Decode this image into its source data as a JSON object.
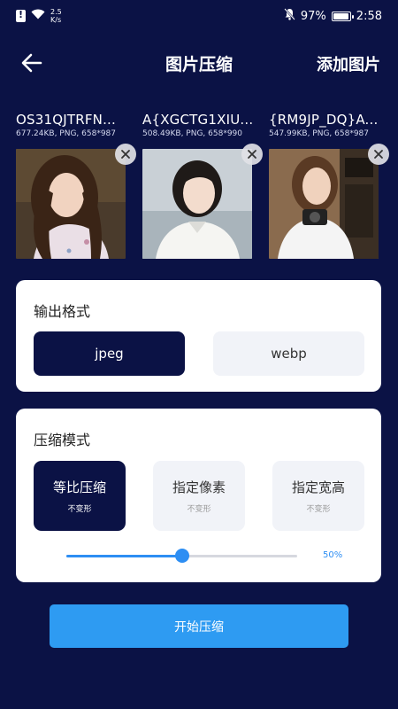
{
  "status_bar": {
    "net_speed_value": "2.5",
    "net_speed_unit": "K/s",
    "battery": "97%",
    "time": "2:58"
  },
  "header": {
    "title": "图片压缩",
    "add_label": "添加图片"
  },
  "images": [
    {
      "name": "OS31QJTRFN...",
      "meta": "677.24KB, PNG, 658*987"
    },
    {
      "name": "A{XGCTG1XIU...",
      "meta": "508.49KB, PNG, 658*990"
    },
    {
      "name": "{RM9JP_DQ}A...",
      "meta": "547.99KB, PNG, 658*987"
    }
  ],
  "output_format": {
    "title": "输出格式",
    "options": [
      "jpeg",
      "webp"
    ],
    "selected": "jpeg"
  },
  "compress_mode": {
    "title": "压缩模式",
    "options": [
      {
        "label": "等比压缩",
        "sub": "不变形"
      },
      {
        "label": "指定像素",
        "sub": "不变形"
      },
      {
        "label": "指定宽高",
        "sub": "不变形"
      }
    ],
    "selected": "等比压缩",
    "quality": 0.5,
    "quality_label": "50%"
  },
  "start_label": "开始压缩",
  "colors": {
    "background": "#0b1245",
    "accent": "#2e9bf2",
    "selected": "#0b1245"
  }
}
